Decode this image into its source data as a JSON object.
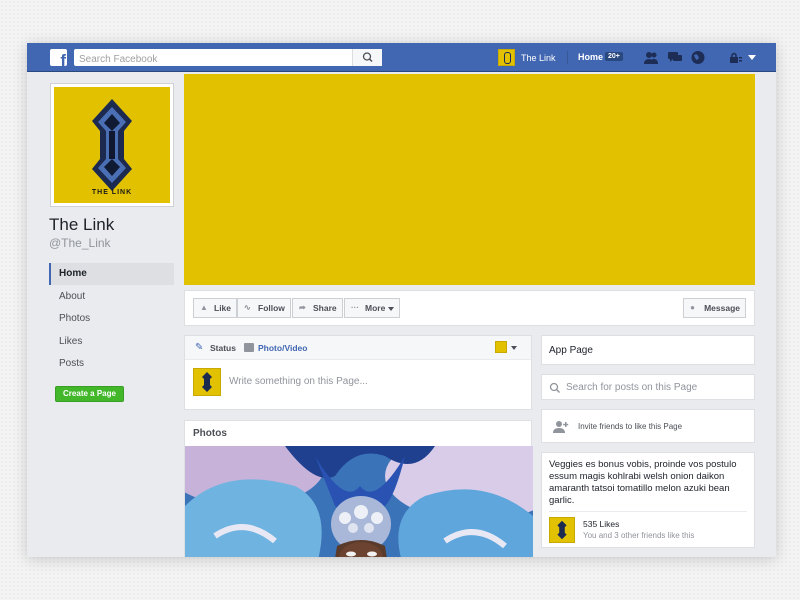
{
  "topbar": {
    "logo": "f",
    "search_placeholder": "Search Facebook",
    "page_name": "The Link",
    "home_label": "Home",
    "home_badge": "20+",
    "icons": [
      "friends-icon",
      "messages-icon",
      "globe-icon",
      "privacy-icon"
    ]
  },
  "profile": {
    "logo_caption": "THE LINK",
    "name": "The Link",
    "handle": "@The_Link"
  },
  "nav": {
    "items": [
      {
        "label": "Home",
        "active": true
      },
      {
        "label": "About"
      },
      {
        "label": "Photos"
      },
      {
        "label": "Likes"
      },
      {
        "label": "Posts"
      }
    ],
    "create_page": "Create a Page"
  },
  "actions": {
    "like": "Like",
    "follow": "Follow",
    "share": "Share",
    "more": "More",
    "message": "Message"
  },
  "composer": {
    "status_tab": "Status",
    "photo_tab": "Photo/Video",
    "placeholder": "Write something on this Page..."
  },
  "photos": {
    "title": "Photos"
  },
  "right": {
    "app_page": "App Page",
    "search_placeholder": "Search for posts on this Page",
    "invite": "Invite friends to like this Page",
    "about_text": "Veggies es bonus vobis, proinde vos postulo essum magis kohlrabi welsh onion daikon amaranth tatsoi tomatillo melon azuki bean garlic.",
    "likes_count": "535 Likes",
    "likes_sub": "You and 3 other friends like this"
  },
  "colors": {
    "brand_blue": "#4267b2",
    "cover_yellow": "#e2c200",
    "create_green": "#42b72a"
  }
}
